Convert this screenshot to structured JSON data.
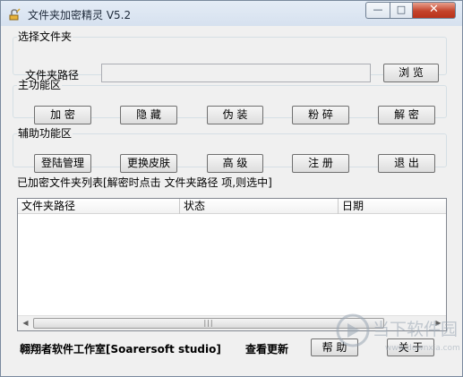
{
  "window": {
    "title": "文件夹加密精灵 V5.2",
    "controls": {
      "minimize": "—",
      "maximize": "□",
      "close": "✕"
    }
  },
  "select_folder": {
    "legend": "选择文件夹",
    "path_label": "文件夹路径",
    "path_value": "",
    "browse_label": "浏 览"
  },
  "main_functions": {
    "legend": "主功能区",
    "buttons": [
      "加  密",
      "隐 藏",
      "伪 装",
      "粉 碎",
      "解  密"
    ]
  },
  "aux_functions": {
    "legend": "辅助功能区",
    "buttons": [
      "登陆管理",
      "更换皮肤",
      "高 级",
      "注 册",
      "退 出"
    ]
  },
  "encrypted_list": {
    "legend": "已加密文件夹列表[解密时点击 文件夹路径 项,则选中]",
    "columns": [
      "文件夹路径",
      "状态",
      "日期"
    ],
    "rows": [],
    "scroll_grip": "|||"
  },
  "footer": {
    "studio": "翱翔者软件工作室[Soarersoft studio]",
    "check_update": "查看更新",
    "help_label": "帮 助",
    "about_label": "关 于"
  },
  "watermark": {
    "text": "当下软件园",
    "url": "www.downxia.com"
  },
  "colors": {
    "titlebar": "#dbe5f1",
    "close_button": "#c4432b",
    "client": "#f0f0f0"
  }
}
